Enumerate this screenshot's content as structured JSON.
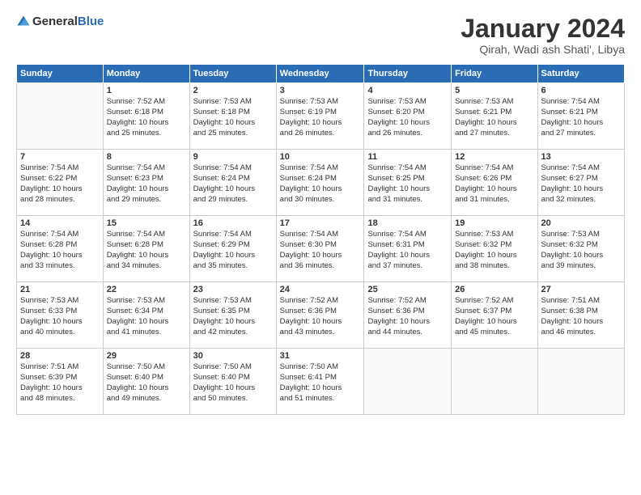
{
  "header": {
    "logo_general": "General",
    "logo_blue": "Blue",
    "month_title": "January 2024",
    "location": "Qirah, Wadi ash Shati', Libya"
  },
  "days_of_week": [
    "Sunday",
    "Monday",
    "Tuesday",
    "Wednesday",
    "Thursday",
    "Friday",
    "Saturday"
  ],
  "weeks": [
    [
      {
        "day": "",
        "content": ""
      },
      {
        "day": "1",
        "content": "Sunrise: 7:52 AM\nSunset: 6:18 PM\nDaylight: 10 hours\nand 25 minutes."
      },
      {
        "day": "2",
        "content": "Sunrise: 7:53 AM\nSunset: 6:18 PM\nDaylight: 10 hours\nand 25 minutes."
      },
      {
        "day": "3",
        "content": "Sunrise: 7:53 AM\nSunset: 6:19 PM\nDaylight: 10 hours\nand 26 minutes."
      },
      {
        "day": "4",
        "content": "Sunrise: 7:53 AM\nSunset: 6:20 PM\nDaylight: 10 hours\nand 26 minutes."
      },
      {
        "day": "5",
        "content": "Sunrise: 7:53 AM\nSunset: 6:21 PM\nDaylight: 10 hours\nand 27 minutes."
      },
      {
        "day": "6",
        "content": "Sunrise: 7:54 AM\nSunset: 6:21 PM\nDaylight: 10 hours\nand 27 minutes."
      }
    ],
    [
      {
        "day": "7",
        "content": "Sunrise: 7:54 AM\nSunset: 6:22 PM\nDaylight: 10 hours\nand 28 minutes."
      },
      {
        "day": "8",
        "content": "Sunrise: 7:54 AM\nSunset: 6:23 PM\nDaylight: 10 hours\nand 29 minutes."
      },
      {
        "day": "9",
        "content": "Sunrise: 7:54 AM\nSunset: 6:24 PM\nDaylight: 10 hours\nand 29 minutes."
      },
      {
        "day": "10",
        "content": "Sunrise: 7:54 AM\nSunset: 6:24 PM\nDaylight: 10 hours\nand 30 minutes."
      },
      {
        "day": "11",
        "content": "Sunrise: 7:54 AM\nSunset: 6:25 PM\nDaylight: 10 hours\nand 31 minutes."
      },
      {
        "day": "12",
        "content": "Sunrise: 7:54 AM\nSunset: 6:26 PM\nDaylight: 10 hours\nand 31 minutes."
      },
      {
        "day": "13",
        "content": "Sunrise: 7:54 AM\nSunset: 6:27 PM\nDaylight: 10 hours\nand 32 minutes."
      }
    ],
    [
      {
        "day": "14",
        "content": "Sunrise: 7:54 AM\nSunset: 6:28 PM\nDaylight: 10 hours\nand 33 minutes."
      },
      {
        "day": "15",
        "content": "Sunrise: 7:54 AM\nSunset: 6:28 PM\nDaylight: 10 hours\nand 34 minutes."
      },
      {
        "day": "16",
        "content": "Sunrise: 7:54 AM\nSunset: 6:29 PM\nDaylight: 10 hours\nand 35 minutes."
      },
      {
        "day": "17",
        "content": "Sunrise: 7:54 AM\nSunset: 6:30 PM\nDaylight: 10 hours\nand 36 minutes."
      },
      {
        "day": "18",
        "content": "Sunrise: 7:54 AM\nSunset: 6:31 PM\nDaylight: 10 hours\nand 37 minutes."
      },
      {
        "day": "19",
        "content": "Sunrise: 7:53 AM\nSunset: 6:32 PM\nDaylight: 10 hours\nand 38 minutes."
      },
      {
        "day": "20",
        "content": "Sunrise: 7:53 AM\nSunset: 6:32 PM\nDaylight: 10 hours\nand 39 minutes."
      }
    ],
    [
      {
        "day": "21",
        "content": "Sunrise: 7:53 AM\nSunset: 6:33 PM\nDaylight: 10 hours\nand 40 minutes."
      },
      {
        "day": "22",
        "content": "Sunrise: 7:53 AM\nSunset: 6:34 PM\nDaylight: 10 hours\nand 41 minutes."
      },
      {
        "day": "23",
        "content": "Sunrise: 7:53 AM\nSunset: 6:35 PM\nDaylight: 10 hours\nand 42 minutes."
      },
      {
        "day": "24",
        "content": "Sunrise: 7:52 AM\nSunset: 6:36 PM\nDaylight: 10 hours\nand 43 minutes."
      },
      {
        "day": "25",
        "content": "Sunrise: 7:52 AM\nSunset: 6:36 PM\nDaylight: 10 hours\nand 44 minutes."
      },
      {
        "day": "26",
        "content": "Sunrise: 7:52 AM\nSunset: 6:37 PM\nDaylight: 10 hours\nand 45 minutes."
      },
      {
        "day": "27",
        "content": "Sunrise: 7:51 AM\nSunset: 6:38 PM\nDaylight: 10 hours\nand 46 minutes."
      }
    ],
    [
      {
        "day": "28",
        "content": "Sunrise: 7:51 AM\nSunset: 6:39 PM\nDaylight: 10 hours\nand 48 minutes."
      },
      {
        "day": "29",
        "content": "Sunrise: 7:50 AM\nSunset: 6:40 PM\nDaylight: 10 hours\nand 49 minutes."
      },
      {
        "day": "30",
        "content": "Sunrise: 7:50 AM\nSunset: 6:40 PM\nDaylight: 10 hours\nand 50 minutes."
      },
      {
        "day": "31",
        "content": "Sunrise: 7:50 AM\nSunset: 6:41 PM\nDaylight: 10 hours\nand 51 minutes."
      },
      {
        "day": "",
        "content": ""
      },
      {
        "day": "",
        "content": ""
      },
      {
        "day": "",
        "content": ""
      }
    ]
  ]
}
